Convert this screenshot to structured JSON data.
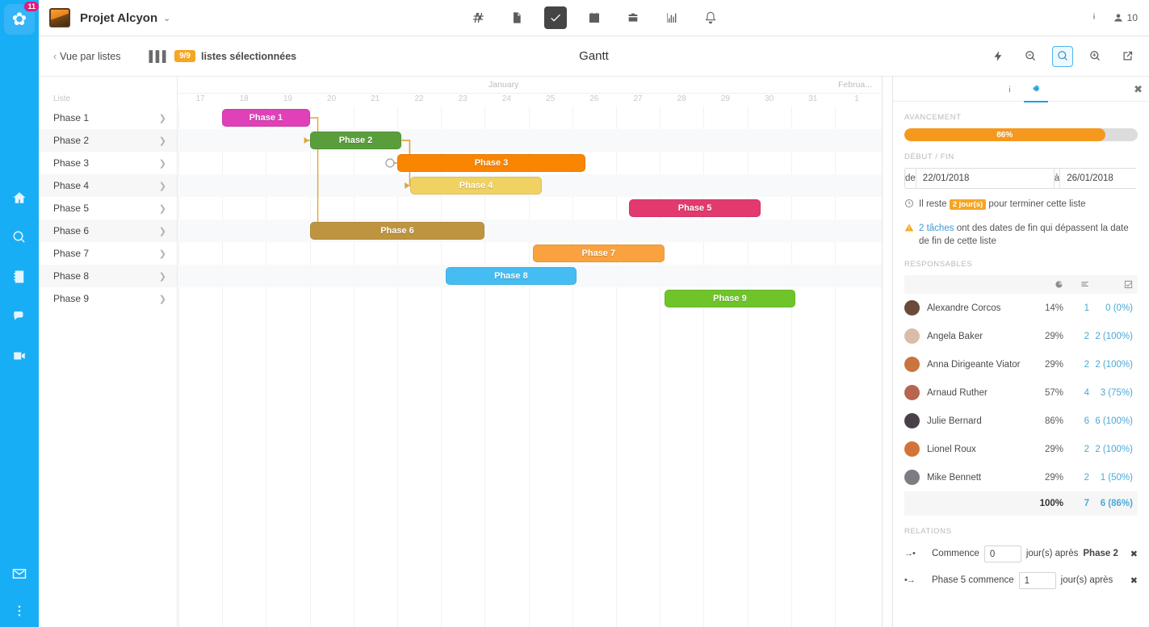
{
  "rail": {
    "badge": "11",
    "logo_glyph": "✿",
    "icons": [
      {
        "name": "home-icon"
      },
      {
        "name": "search-icon"
      },
      {
        "name": "contacts-icon"
      },
      {
        "name": "chat-icon"
      },
      {
        "name": "video-icon"
      }
    ],
    "bottom_icons": [
      {
        "name": "mail-icon"
      },
      {
        "name": "more-vertical-icon"
      }
    ]
  },
  "topbar": {
    "project_title": "Projet Alcyon",
    "caret": "⌄",
    "nav": [
      {
        "name": "tab-hash",
        "active": false
      },
      {
        "name": "tab-documents",
        "active": false
      },
      {
        "name": "tab-tasks",
        "active": true
      },
      {
        "name": "tab-calendar",
        "active": false
      },
      {
        "name": "tab-briefcase",
        "active": false
      },
      {
        "name": "tab-reports",
        "active": false
      },
      {
        "name": "tab-notifications",
        "active": false
      }
    ],
    "info_label": "",
    "user_count": "10"
  },
  "subbar": {
    "back_label": "Vue par listes",
    "back_chevron": "‹",
    "lists_badge": "9/9",
    "lists_label": "listes sélectionnées",
    "title": "Gantt",
    "actions": [
      {
        "name": "quick-action-button",
        "active": false
      },
      {
        "name": "zoom-out-button",
        "active": false
      },
      {
        "name": "zoom-fit-button",
        "active": true
      },
      {
        "name": "zoom-in-button",
        "active": false
      },
      {
        "name": "open-external-button",
        "active": false
      }
    ]
  },
  "gantt": {
    "left_header": "Liste",
    "month_left": "January",
    "month_right": "Februa...",
    "days": [
      "17",
      "18",
      "19",
      "20",
      "21",
      "22",
      "23",
      "24",
      "25",
      "26",
      "27",
      "28",
      "29",
      "30",
      "31",
      "1"
    ],
    "rows": [
      {
        "label": "Phase 1"
      },
      {
        "label": "Phase 2"
      },
      {
        "label": "Phase 3"
      },
      {
        "label": "Phase 4"
      },
      {
        "label": "Phase 5"
      },
      {
        "label": "Phase 6"
      },
      {
        "label": "Phase 7"
      },
      {
        "label": "Phase 8"
      },
      {
        "label": "Phase 9"
      }
    ],
    "bars": [
      {
        "label": "Phase 1",
        "row": 0,
        "start_day": 1.0,
        "span_days": 2.0,
        "color": "#e040b8"
      },
      {
        "label": "Phase 2",
        "row": 1,
        "start_day": 3.0,
        "span_days": 2.1,
        "color": "#5a9e3c"
      },
      {
        "label": "Phase 3",
        "row": 2,
        "start_day": 5.0,
        "span_days": 4.3,
        "color": "#fa8500"
      },
      {
        "label": "Phase 4",
        "row": 3,
        "start_day": 5.3,
        "span_days": 3.0,
        "color": "#f0d262"
      },
      {
        "label": "Phase 5",
        "row": 4,
        "start_day": 10.3,
        "span_days": 3.0,
        "color": "#e23a6e"
      },
      {
        "label": "Phase 6",
        "row": 5,
        "start_day": 3.0,
        "span_days": 4.0,
        "color": "#bf9440"
      },
      {
        "label": "Phase 7",
        "row": 6,
        "start_day": 8.1,
        "span_days": 3.0,
        "color": "#f9a23f"
      },
      {
        "label": "Phase 8",
        "row": 7,
        "start_day": 6.1,
        "span_days": 3.0,
        "color": "#45bdf2"
      },
      {
        "label": "Phase 9",
        "row": 8,
        "start_day": 11.1,
        "span_days": 3.0,
        "color": "#6fc42a"
      }
    ],
    "link_color": "#e0a33a",
    "scroll_up": "▲",
    "scroll_down": "▼"
  },
  "panel": {
    "tabs": [
      {
        "name": "panel-tab-info",
        "active": false
      },
      {
        "name": "panel-tab-settings",
        "active": true
      }
    ],
    "close": "✖",
    "progress_label": "AVANCEMENT",
    "progress_value": "86%",
    "progress_pct": 86,
    "progress_color": "#f5981e",
    "dates_label": "DÉBUT / FIN",
    "date_from_label": "de",
    "date_from": "22/01/2018",
    "date_to_label": "à",
    "date_to": "26/01/2018",
    "remaining_prefix": "Il reste",
    "remaining_pill": "2 jour(s)",
    "remaining_suffix": "pour terminer cette liste",
    "warn_link": "2 tâches",
    "warn_text": "ont des dates de fin qui dépassent la date de fin de cette liste",
    "responsables_label": "RESPONSABLES",
    "col_icons": [
      "pie-chart-icon",
      "list-icon",
      "checkbox-icon"
    ],
    "responsables": [
      {
        "name": "Alexandre Corcos",
        "pct": "14%",
        "tasks": "1",
        "done": "0 (0%)",
        "avatar": "#6b4a3a"
      },
      {
        "name": "Angela Baker",
        "pct": "29%",
        "tasks": "2",
        "done": "2 (100%)",
        "avatar": "#d9bda8"
      },
      {
        "name": "Anna Dirigeante Viator",
        "pct": "29%",
        "tasks": "2",
        "done": "2 (100%)",
        "avatar": "#c8753f"
      },
      {
        "name": "Arnaud Ruther",
        "pct": "57%",
        "tasks": "4",
        "done": "3 (75%)",
        "avatar": "#b8654f"
      },
      {
        "name": "Julie Bernard",
        "pct": "86%",
        "tasks": "6",
        "done": "6 (100%)",
        "avatar": "#4a4148"
      },
      {
        "name": "Lionel Roux",
        "pct": "29%",
        "tasks": "2",
        "done": "2 (100%)",
        "avatar": "#d2743a"
      },
      {
        "name": "Mike Bennett",
        "pct": "29%",
        "tasks": "2",
        "done": "1 (50%)",
        "avatar": "#7c7c82"
      }
    ],
    "total": {
      "pct": "100%",
      "tasks": "7",
      "done": "6 (86%)"
    },
    "relations_label": "RELATIONS",
    "relations": [
      {
        "icon": "arrow-to-dot-icon",
        "prefix": "Commence",
        "value": "0",
        "suffix": "jour(s) après",
        "target": "Phase 2",
        "remove": "✖"
      },
      {
        "icon": "dot-to-arrow-icon",
        "prefix": "Phase 5 commence",
        "value": "1",
        "suffix": "jour(s) après",
        "target": "",
        "remove": "✖"
      }
    ]
  }
}
